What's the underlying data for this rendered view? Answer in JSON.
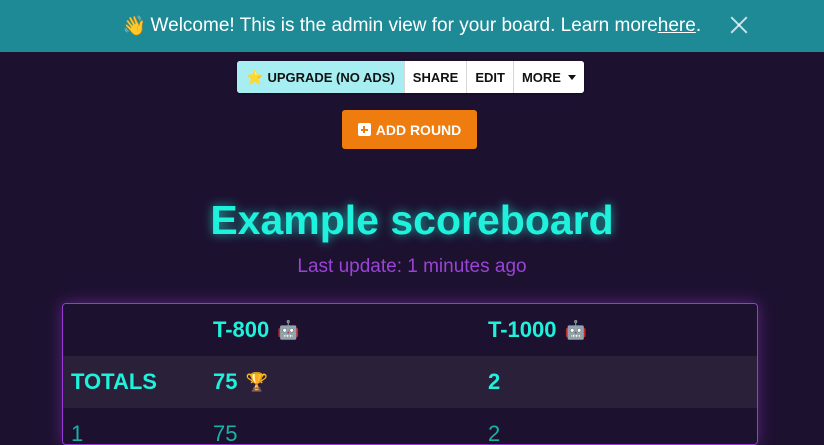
{
  "banner": {
    "wave_icon": "👋",
    "text": "Welcome! This is the admin view for your board. Learn more ",
    "link": "here",
    "tail": "."
  },
  "toolbar": {
    "upgrade_icon": "⭐",
    "upgrade": "UPGRADE (NO ADS)",
    "share": "SHARE",
    "edit": "EDIT",
    "more": "MORE"
  },
  "add_round": {
    "label": "ADD ROUND"
  },
  "board": {
    "title": "Example scoreboard",
    "last_update": "Last update: 1 minutes ago",
    "teams": [
      {
        "name": "T-800",
        "icon": "🤖"
      },
      {
        "name": "T-1000",
        "icon": "🤖"
      }
    ],
    "totals": {
      "label": "TOTALS",
      "values": [
        "75",
        "2"
      ],
      "winner_icon": "🏆"
    },
    "rounds": [
      {
        "label": "1",
        "values": [
          "75",
          "2"
        ]
      }
    ]
  },
  "colors": {
    "background": "#1d1130",
    "banner": "#1e8a96",
    "accent": "#1ef2dc",
    "subtitle": "#9a43d6",
    "add_round": "#ee7c0e"
  }
}
